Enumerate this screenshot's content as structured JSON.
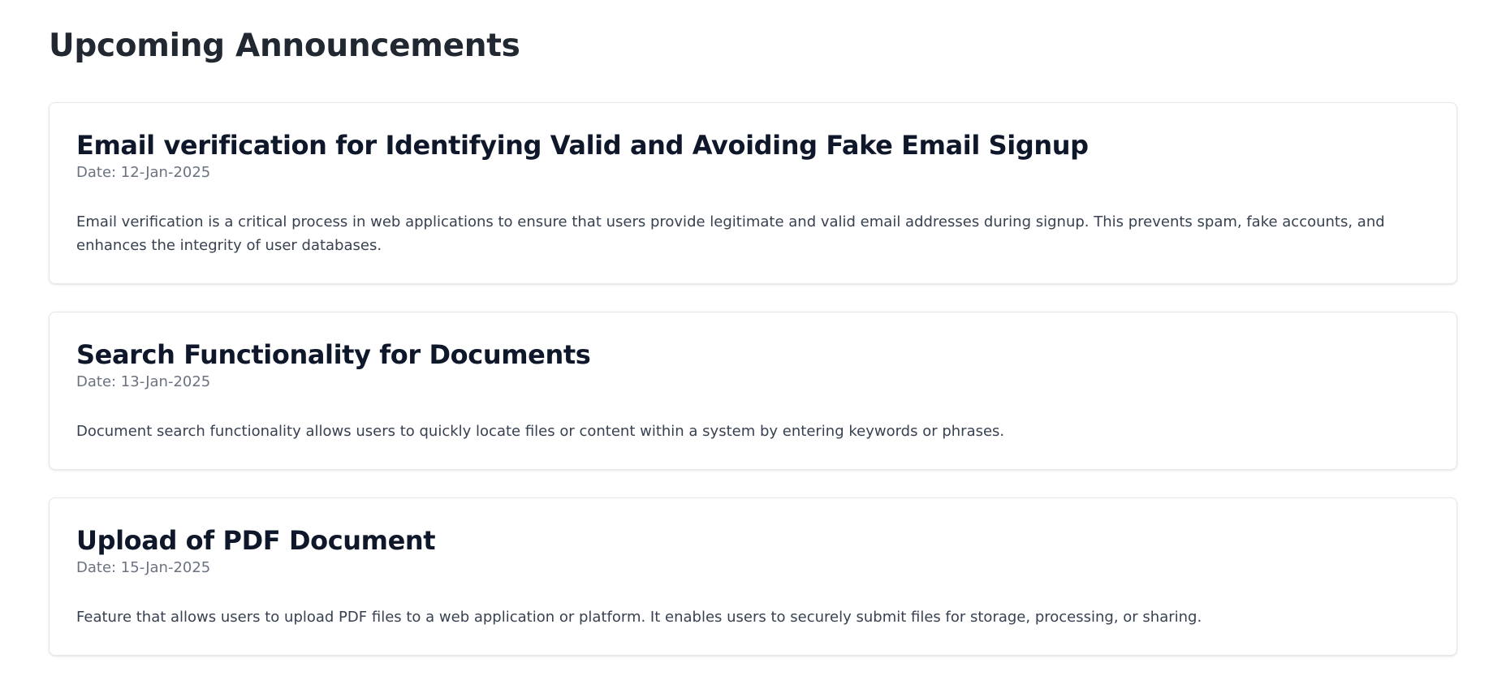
{
  "page": {
    "title": "Upcoming Announcements"
  },
  "announcements": [
    {
      "title": "Email verification for Identifying Valid and Avoiding Fake Email Signup",
      "date": "Date: 12-Jan-2025",
      "description": "Email verification is a critical process in web applications to ensure that users provide legitimate and valid email addresses during signup. This prevents spam, fake accounts, and enhances the integrity of user databases."
    },
    {
      "title": "Search Functionality for Documents",
      "date": "Date: 13-Jan-2025",
      "description": "Document search functionality allows users to quickly locate files or content within a system by entering keywords or phrases."
    },
    {
      "title": "Upload of PDF Document",
      "date": "Date: 15-Jan-2025",
      "description": "Feature that allows users to upload PDF files to a web application or platform. It enables users to securely submit files for storage, processing, or sharing."
    }
  ]
}
